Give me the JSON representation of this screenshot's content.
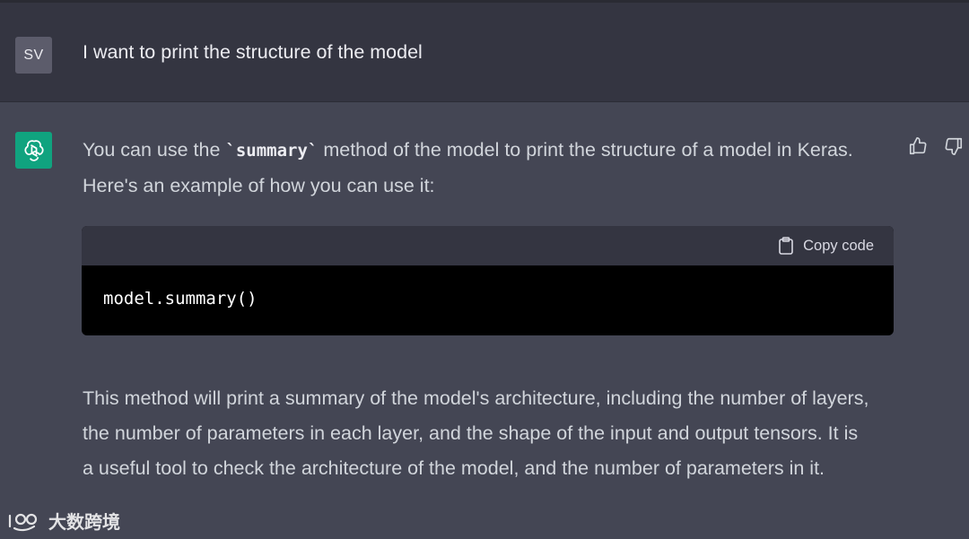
{
  "user_message": {
    "avatar_initials": "SV",
    "text": "I want to print the structure of the model"
  },
  "assistant_message": {
    "avatar_icon": "openai-logo-icon",
    "para1_before": "You can use the ",
    "para1_code": "`summary`",
    "para1_after": " method of the model to print the structure of a model in Keras. Here's an example of how you can use it:",
    "code_block": {
      "copy_label": "Copy code",
      "code": "model.summary()"
    },
    "para2": "This method will print a summary of the model's architecture, including the number of layers, the number of parameters in each layer, and the shape of the input and output tensors. It is a useful tool to check the architecture of the model, and the number of parameters in it."
  },
  "feedback": {
    "thumbs_up_icon": "thumbs-up-icon",
    "thumbs_down_icon": "thumbs-down-icon"
  },
  "watermark": {
    "text": "大数跨境"
  },
  "colors": {
    "user_bg": "#343541",
    "assistant_bg": "#444654",
    "brand_green": "#10a37f"
  }
}
